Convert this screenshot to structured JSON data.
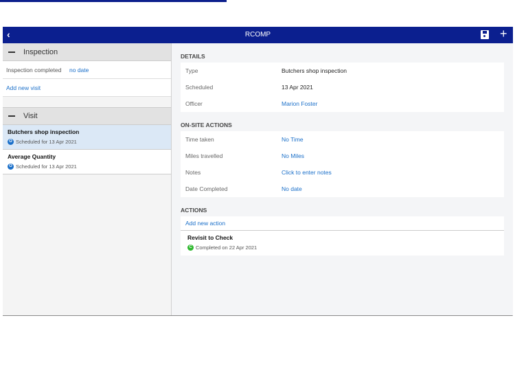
{
  "header": {
    "title": "RCOMP"
  },
  "colors": {
    "brand": "#0b1f8f",
    "link": "#1a6fc9",
    "scheduled": "#1a6fc9",
    "completed": "#2eb82e"
  },
  "left": {
    "inspection": {
      "title": "Inspection",
      "completed_label": "Inspection completed",
      "completed_value": "no date",
      "add_visit": "Add new visit"
    },
    "visit": {
      "title": "Visit",
      "items": [
        {
          "title": "Butchers shop inspection",
          "status": "Scheduled for 13 Apr 2021",
          "icon": "O"
        },
        {
          "title": "Average Quantity",
          "status": "Scheduled for 13 Apr 2021",
          "icon": "O"
        }
      ]
    }
  },
  "details": {
    "heading": "DETAILS",
    "rows": [
      {
        "label": "Type",
        "value": "Butchers shop inspection"
      },
      {
        "label": "Scheduled",
        "value": "13 Apr 2021"
      },
      {
        "label": "Officer",
        "value": "Marion Foster"
      }
    ]
  },
  "onsite": {
    "heading": "ON-SITE ACTIONS",
    "rows": [
      {
        "label": "Time taken",
        "value": "No Time"
      },
      {
        "label": "Miles travelled",
        "value": "No Miles"
      },
      {
        "label": "Notes",
        "value": "Click to enter notes"
      },
      {
        "label": "Date Completed",
        "value": "No date"
      }
    ]
  },
  "actions": {
    "heading": "ACTIONS",
    "add": "Add new action",
    "items": [
      {
        "title": "Revisit to Check",
        "status": "Completed on 22 Apr 2021",
        "icon": "C"
      }
    ]
  }
}
